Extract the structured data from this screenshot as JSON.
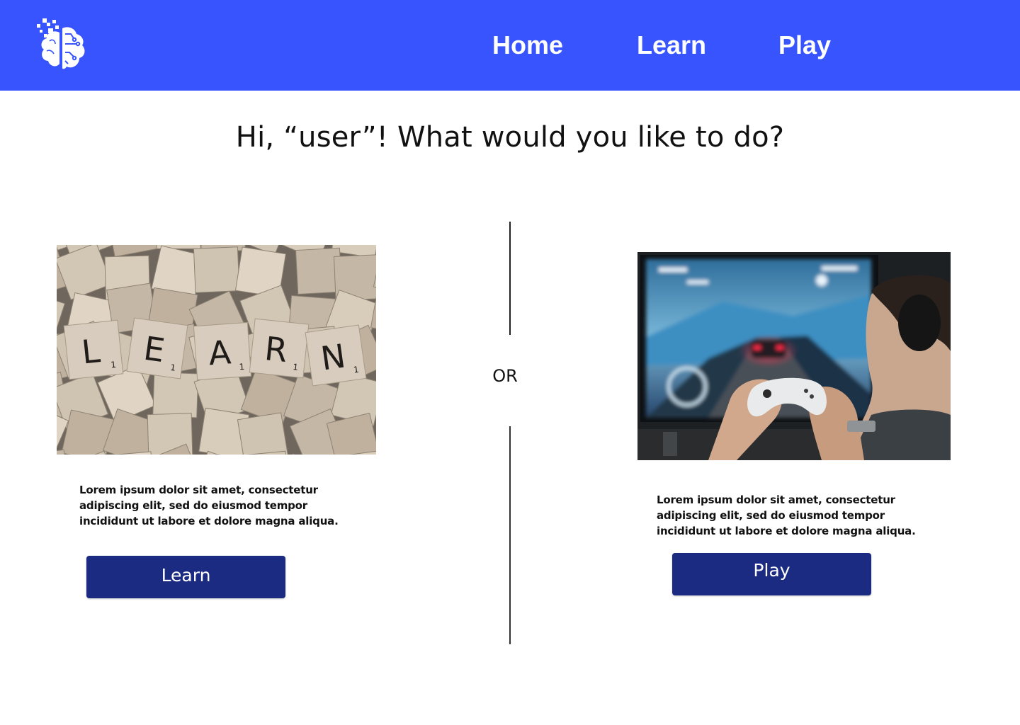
{
  "nav": {
    "logo_icon": "brain-circuit-logo-icon",
    "items": [
      {
        "label": "Home"
      },
      {
        "label": "Learn"
      },
      {
        "label": "Play"
      }
    ],
    "background": "#3754fe"
  },
  "main": {
    "greeting": "Hi, “user”! What would you like to do?",
    "or_label": "OR",
    "learn": {
      "image_icon": "scrabble-tiles-learn-image",
      "description": "Lorem ipsum dolor sit amet, consectetur adipiscing elit, sed do eiusmod tempor incididunt ut labore et dolore magna aliqua.",
      "button_label": "Learn",
      "tiles": [
        "L",
        "E",
        "A",
        "R",
        "N"
      ],
      "tile_scores": [
        "1",
        "1",
        "1",
        "1",
        "1"
      ]
    },
    "play": {
      "image_icon": "gamer-with-controller-image",
      "description": "Lorem ipsum dolor sit amet, consectetur adipiscing elit, sed do eiusmod tempor incididunt ut labore et dolore magna aliqua.",
      "button_label": "Play"
    },
    "button_color": "#1b2b82"
  }
}
